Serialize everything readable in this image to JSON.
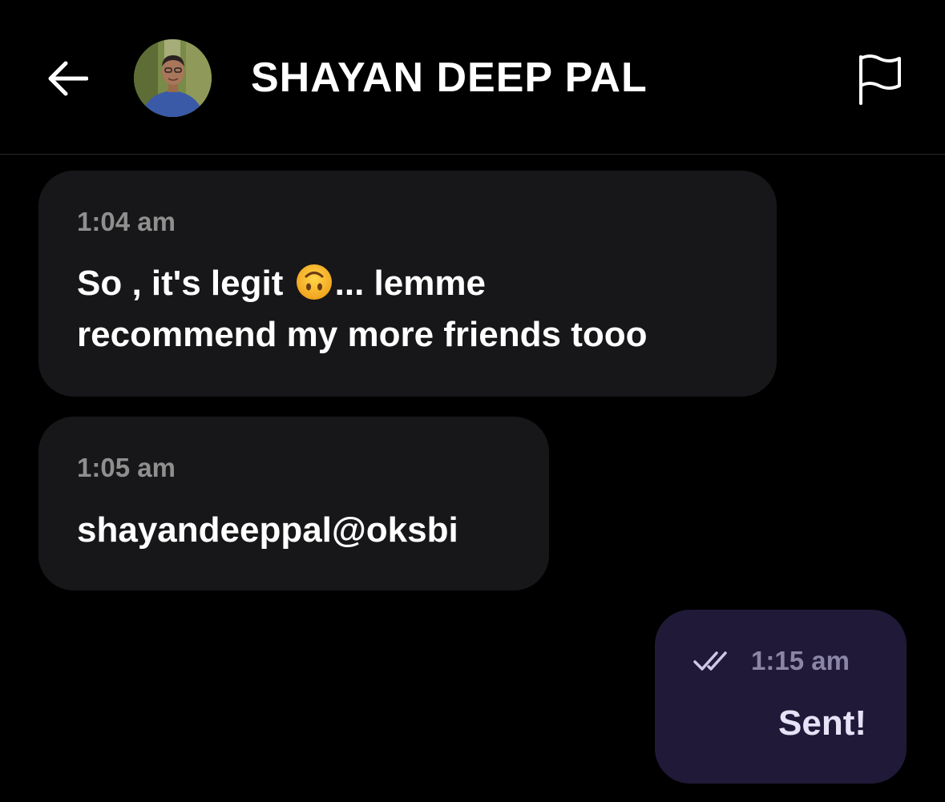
{
  "header": {
    "back_icon": "arrow-left-icon",
    "contact_name": "SHAYAN DEEP PAL",
    "report_icon": "flag-icon"
  },
  "messages": [
    {
      "direction": "incoming",
      "time": "1:04 am",
      "text_part1": "So , it's legit",
      "emoji": "upside-down-face",
      "text_part2": "... lemme",
      "text_line2": "recommend my more friends tooo"
    },
    {
      "direction": "incoming",
      "time": "1:05 am",
      "text": "shayandeeppal@oksbi"
    },
    {
      "direction": "outgoing",
      "status_icon": "double-check-icon",
      "time": "1:15 am",
      "text": "Sent!"
    }
  ],
  "colors": {
    "background": "#000000",
    "incoming_bubble": "#171719",
    "outgoing_bubble": "#201a38",
    "timestamp": "#8f8f8f",
    "text": "#ffffff"
  }
}
